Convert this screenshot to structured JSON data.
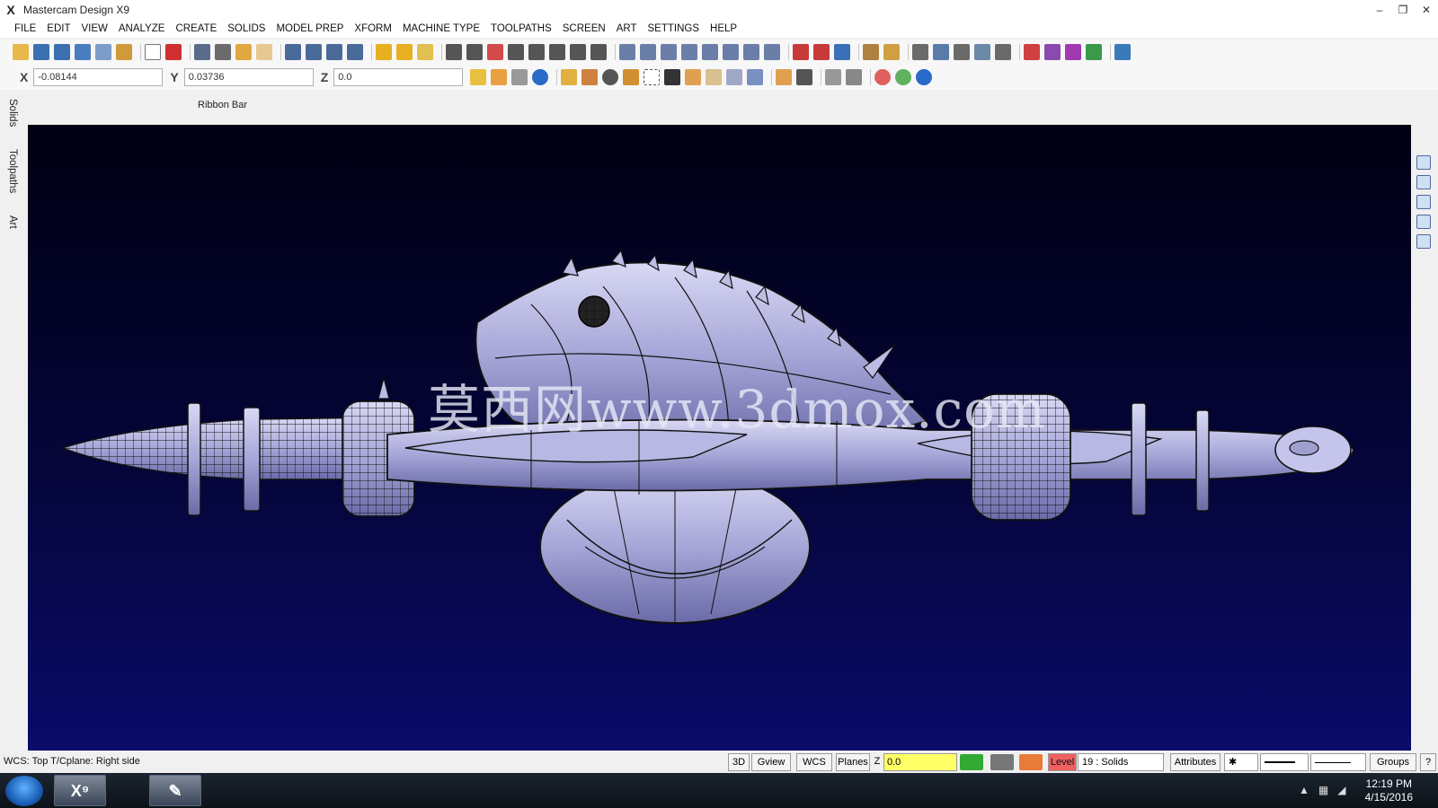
{
  "window": {
    "title": "Mastercam Design X9",
    "logo": "X",
    "controls": [
      "–",
      "❐",
      "✕"
    ]
  },
  "menu": [
    "FILE",
    "EDIT",
    "VIEW",
    "ANALYZE",
    "CREATE",
    "SOLIDS",
    "MODEL PREP",
    "XFORM",
    "MACHINE TYPE",
    "TOOLPATHS",
    "SCREEN",
    "ART",
    "SETTINGS",
    "HELP"
  ],
  "coords": {
    "x_label": "X",
    "x_value": "-0.08144",
    "y_label": "Y",
    "y_value": "0.03736",
    "z_label": "Z",
    "z_value": "0.0"
  },
  "ribbon": {
    "label": "Ribbon Bar"
  },
  "left_tabs": [
    "Solids",
    "Toolpaths",
    "Art"
  ],
  "viewport": {
    "watermark": "莫西网www.3dmox.com"
  },
  "status": {
    "text": "WCS: Top  T/Cplane: Right side",
    "btn_3d": "3D",
    "btn_gview": "Gview",
    "btn_wcs": "WCS",
    "btn_planes": "Planes",
    "z_label": "Z",
    "z_value": "0.0",
    "level_label": "Level",
    "level_value": "19 : Solids",
    "attributes": "Attributes",
    "groups": "Groups",
    "help": "?"
  },
  "taskbar": {
    "time": "12:19 PM",
    "date": "4/15/2016"
  },
  "colors": {
    "viewport_top": "#000012",
    "viewport_bottom": "#0b0b6a",
    "model_fill": "#a8a8d8",
    "z_field": "#ffff66",
    "level": "#f06060"
  }
}
